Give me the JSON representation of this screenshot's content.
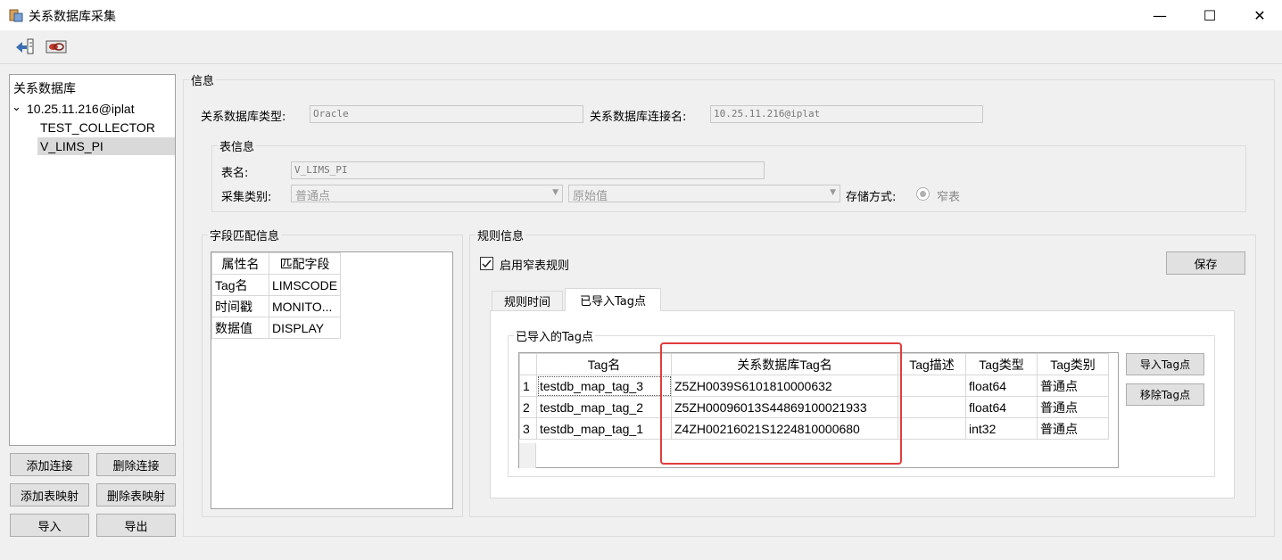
{
  "window": {
    "title": "关系数据库采集",
    "minimize": "—",
    "maximize": "☐",
    "close": "✕"
  },
  "toolbar": {
    "icon1": "import-icon",
    "icon2": "connect-icon"
  },
  "tree": {
    "root": "关系数据库",
    "expander": "⌄",
    "connection": "10.25.11.216@iplat",
    "children": [
      "TEST_COLLECTOR",
      "V_LIMS_PI"
    ]
  },
  "left_buttons": {
    "add_connection": "添加连接",
    "delete_connection": "删除连接",
    "add_table_mapping": "添加表映射",
    "delete_table_mapping": "删除表映射",
    "import": "导入",
    "export": "导出"
  },
  "info": {
    "group_title": "信息",
    "db_type_label": "关系数据库类型:",
    "db_type_value": "Oracle",
    "conn_name_label": "关系数据库连接名:",
    "conn_name_value": "10.25.11.216@iplat"
  },
  "table_info": {
    "group_title": "表信息",
    "table_name_label": "表名:",
    "table_name_value": "V_LIMS_PI",
    "collect_type_label": "采集类别:",
    "collect_type_value": "普通点",
    "value_type_value": "原始值",
    "storage_label": "存储方式:",
    "storage_value": "窄表"
  },
  "field_match": {
    "group_title": "字段匹配信息",
    "headers": [
      "属性名",
      "匹配字段"
    ],
    "rows": [
      [
        "Tag名",
        "LIMSCODE"
      ],
      [
        "时间戳",
        "MONITO..."
      ],
      [
        "数据值",
        "DISPLAY"
      ]
    ]
  },
  "rules": {
    "group_title": "规则信息",
    "enable_label": "启用窄表规则",
    "enable_checked": true,
    "save_button": "保存",
    "tabs": [
      "规则时间",
      "已导入Tag点"
    ],
    "active_tab": 1
  },
  "imported": {
    "group_title": "已导入的Tag点",
    "headers": [
      "Tag名",
      "关系数据库Tag名",
      "Tag描述",
      "Tag类型",
      "Tag类别"
    ],
    "rows": [
      {
        "num": "1",
        "tag": "testdb_map_tag_3",
        "db_tag": "Z5ZH0039S6101810000632",
        "desc": "",
        "type": "float64",
        "category": "普通点"
      },
      {
        "num": "2",
        "tag": "testdb_map_tag_2",
        "db_tag": "Z5ZH00096013S44869100021933",
        "desc": "",
        "type": "float64",
        "category": "普通点"
      },
      {
        "num": "3",
        "tag": "testdb_map_tag_1",
        "db_tag": "Z4ZH00216021S1224810000680",
        "desc": "",
        "type": "int32",
        "category": "普通点"
      }
    ],
    "import_button": "导入Tag点",
    "remove_button": "移除Tag点"
  },
  "colors": {
    "highlight_border": "#e03c3c",
    "selection": "#d9d9d9"
  }
}
